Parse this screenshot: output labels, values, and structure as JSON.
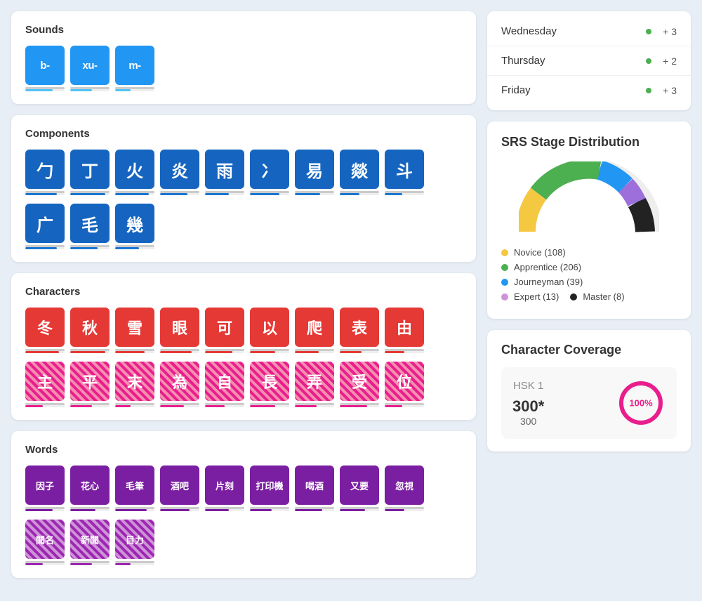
{
  "sounds": {
    "title": "Sounds",
    "tiles": [
      {
        "label": "b-",
        "bar": 70
      },
      {
        "label": "xu-",
        "bar": 55
      },
      {
        "label": "m-",
        "bar": 40
      }
    ]
  },
  "components": {
    "title": "Components",
    "row1": [
      {
        "label": "勹",
        "bar": 80
      },
      {
        "label": "丁",
        "bar": 90
      },
      {
        "label": "火",
        "bar": 85
      },
      {
        "label": "炎",
        "bar": 70
      },
      {
        "label": "雨",
        "bar": 60
      },
      {
        "label": "冫",
        "bar": 75
      },
      {
        "label": "易",
        "bar": 65
      },
      {
        "label": "燚",
        "bar": 50
      },
      {
        "label": "斗",
        "bar": 45
      }
    ],
    "row2": [
      {
        "label": "广",
        "bar": 80
      },
      {
        "label": "毛",
        "bar": 70
      },
      {
        "label": "幾",
        "bar": 60
      }
    ]
  },
  "characters": {
    "title": "Characters",
    "row1": [
      {
        "label": "冬",
        "type": "solid",
        "bar": 85
      },
      {
        "label": "秋",
        "type": "solid",
        "bar": 90
      },
      {
        "label": "雪",
        "type": "solid",
        "bar": 75
      },
      {
        "label": "眼",
        "type": "solid",
        "bar": 80
      },
      {
        "label": "可",
        "type": "solid",
        "bar": 70
      },
      {
        "label": "以",
        "type": "solid",
        "bar": 65
      },
      {
        "label": "爬",
        "type": "solid",
        "bar": 60
      },
      {
        "label": "表",
        "type": "solid",
        "bar": 55
      },
      {
        "label": "由",
        "type": "solid",
        "bar": 50
      }
    ],
    "row2": [
      {
        "label": "主",
        "type": "striped",
        "bar": 45
      },
      {
        "label": "平",
        "type": "striped",
        "bar": 55
      },
      {
        "label": "末",
        "type": "striped",
        "bar": 40
      },
      {
        "label": "為",
        "type": "striped",
        "bar": 60
      },
      {
        "label": "自",
        "type": "striped",
        "bar": 50
      },
      {
        "label": "長",
        "type": "striped",
        "bar": 65
      },
      {
        "label": "弄",
        "type": "striped",
        "bar": 55
      },
      {
        "label": "受",
        "type": "striped",
        "bar": 70
      },
      {
        "label": "位",
        "type": "striped",
        "bar": 45
      }
    ]
  },
  "words": {
    "title": "Words",
    "row1": [
      {
        "label": "因子",
        "type": "solid",
        "bar": 70
      },
      {
        "label": "花心",
        "type": "solid",
        "bar": 65
      },
      {
        "label": "毛筆",
        "type": "solid",
        "bar": 80
      },
      {
        "label": "酒吧",
        "type": "solid",
        "bar": 75
      },
      {
        "label": "片刻",
        "type": "solid",
        "bar": 60
      },
      {
        "label": "打印機",
        "type": "solid",
        "bar": 55
      },
      {
        "label": "喝酒",
        "type": "solid",
        "bar": 70
      },
      {
        "label": "又要",
        "type": "solid",
        "bar": 65
      },
      {
        "label": "忽視",
        "type": "solid",
        "bar": 50
      }
    ],
    "row2": [
      {
        "label": "聞名",
        "type": "striped",
        "bar": 45
      },
      {
        "label": "新聞",
        "type": "striped",
        "bar": 55
      },
      {
        "label": "目力",
        "type": "striped",
        "bar": 40
      }
    ]
  },
  "days": [
    {
      "name": "Wednesday",
      "count": "+ 3"
    },
    {
      "name": "Thursday",
      "count": "+ 2"
    },
    {
      "name": "Friday",
      "count": "+ 3"
    }
  ],
  "srs": {
    "title": "SRS Stage Distribution",
    "legend": [
      {
        "label": "Novice (108)",
        "color": "#f5c842"
      },
      {
        "label": "Apprentice (206)",
        "color": "#4caf50"
      },
      {
        "label": "Journeyman (39)",
        "color": "#2196f3"
      },
      {
        "label": "Expert (13)",
        "color": "#ce93d8"
      },
      {
        "label": "Master (8)",
        "color": "#222"
      }
    ]
  },
  "coverage": {
    "title": "Character Coverage",
    "hsk_label": "HSK  1",
    "count": "300*",
    "total": "300",
    "percent": "100%"
  },
  "bar_colors": {
    "sound": "#4fc3f7",
    "component": "#1976d2",
    "char_solid": "#e53935",
    "char_striped": "#e91e8c",
    "word_solid": "#7b1fa2",
    "word_striped": "#9c27b0"
  }
}
